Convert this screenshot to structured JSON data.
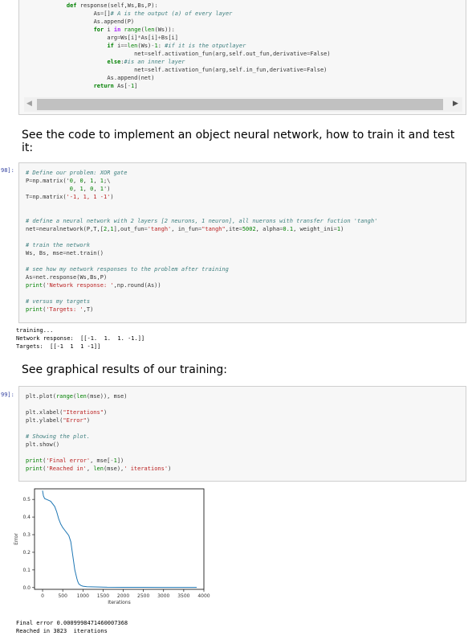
{
  "cell_top": {
    "lines": [
      "    def response(self,Ws,Bs,P):",
      "            As=[]# A is the output (a) of every layer",
      "            As.append(P)",
      "            for i in range(len(Ws)):",
      "                arg=Ws[i]*As[i]+Bs[i]",
      "                if i==len(Ws)-1: #if it is the otputlayer",
      "                        net=self.activation_fun(arg,self.out_fun,derivative=False)",
      "                else:#is an inner layer",
      "                        net=self.activation_fun(arg,self.in_fun,derivative=False)",
      "                As.append(net)",
      "            return As[-1]"
    ]
  },
  "scrollbar": {
    "left_arrow": "◀",
    "right_arrow": "▶"
  },
  "markdown_1": "See the code to implement an object neural network, how to train it and test it:",
  "cell_98": {
    "prompt": "98]:",
    "lines": [
      "# Define our problem: XOR gate",
      "P=np.matrix('0, 0, 1, 1;\\",
      "             0, 1, 0, 1')",
      "T=np.matrix('-1, 1, 1 -1')",
      "",
      "",
      "# define a neural network with 2 layers [2 neurons, 1 neuron], all nuerons with transfer fuction 'tangh'",
      "net=neuralnetwork(P,T,[2,1],out_fun='tangh', in_fun=\"tangh\",ite=5002, alpha=0.1, weight_ini=1)",
      "",
      "# train the network",
      "Ws, Bs, mse=net.train()",
      "",
      "# see how my network responses to the problem after training",
      "As=net.response(Ws,Bs,P)",
      "print('Network response: ',np.round(As))",
      "",
      "# versus my targets",
      "print('Targets: ',T)"
    ]
  },
  "output_98": [
    "training...",
    "Network response:  [[-1.  1.  1. -1.]]",
    "Targets:  [[-1  1  1 -1]]"
  ],
  "markdown_2": "See graphical results of our training:",
  "cell_99": {
    "prompt": "99]:",
    "lines": [
      "plt.plot(range(len(mse)), mse)",
      "",
      "plt.xlabel(\"Iterations\")",
      "plt.ylabel(\"Error\")",
      "",
      "# Showing the plot.",
      "plt.show()",
      "",
      "print('Final error', mse[-1])",
      "print('Reached in', len(mse),' iterations')"
    ]
  },
  "chart_data": {
    "type": "line",
    "title": "",
    "xlabel": "Iterations",
    "ylabel": "Error",
    "xlim": [
      -200,
      4000
    ],
    "ylim": [
      -0.01,
      0.56
    ],
    "xticks": [
      0,
      500,
      1000,
      1500,
      2000,
      2500,
      3000,
      3500,
      4000
    ],
    "yticks": [
      0.0,
      0.1,
      0.2,
      0.3,
      0.4,
      0.5
    ],
    "grid": false,
    "series": [
      {
        "color": "#1f77b4",
        "x": [
          0,
          20,
          50,
          100,
          200,
          300,
          350,
          400,
          450,
          500,
          550,
          600,
          650,
          700,
          750,
          800,
          850,
          870,
          900,
          950,
          1000,
          1100,
          1200,
          1400,
          1600,
          2000,
          2500,
          3000,
          3500,
          3823
        ],
        "y": [
          0.55,
          0.52,
          0.505,
          0.5,
          0.49,
          0.46,
          0.43,
          0.39,
          0.36,
          0.34,
          0.325,
          0.31,
          0.295,
          0.26,
          0.18,
          0.1,
          0.05,
          0.035,
          0.02,
          0.012,
          0.008,
          0.005,
          0.004,
          0.003,
          0.002,
          0.0015,
          0.0012,
          0.001,
          0.001,
          0.0009
        ]
      }
    ]
  },
  "output_99": [
    "Final error 0.0009998471460007368",
    "Reached in 3823  iterations"
  ]
}
